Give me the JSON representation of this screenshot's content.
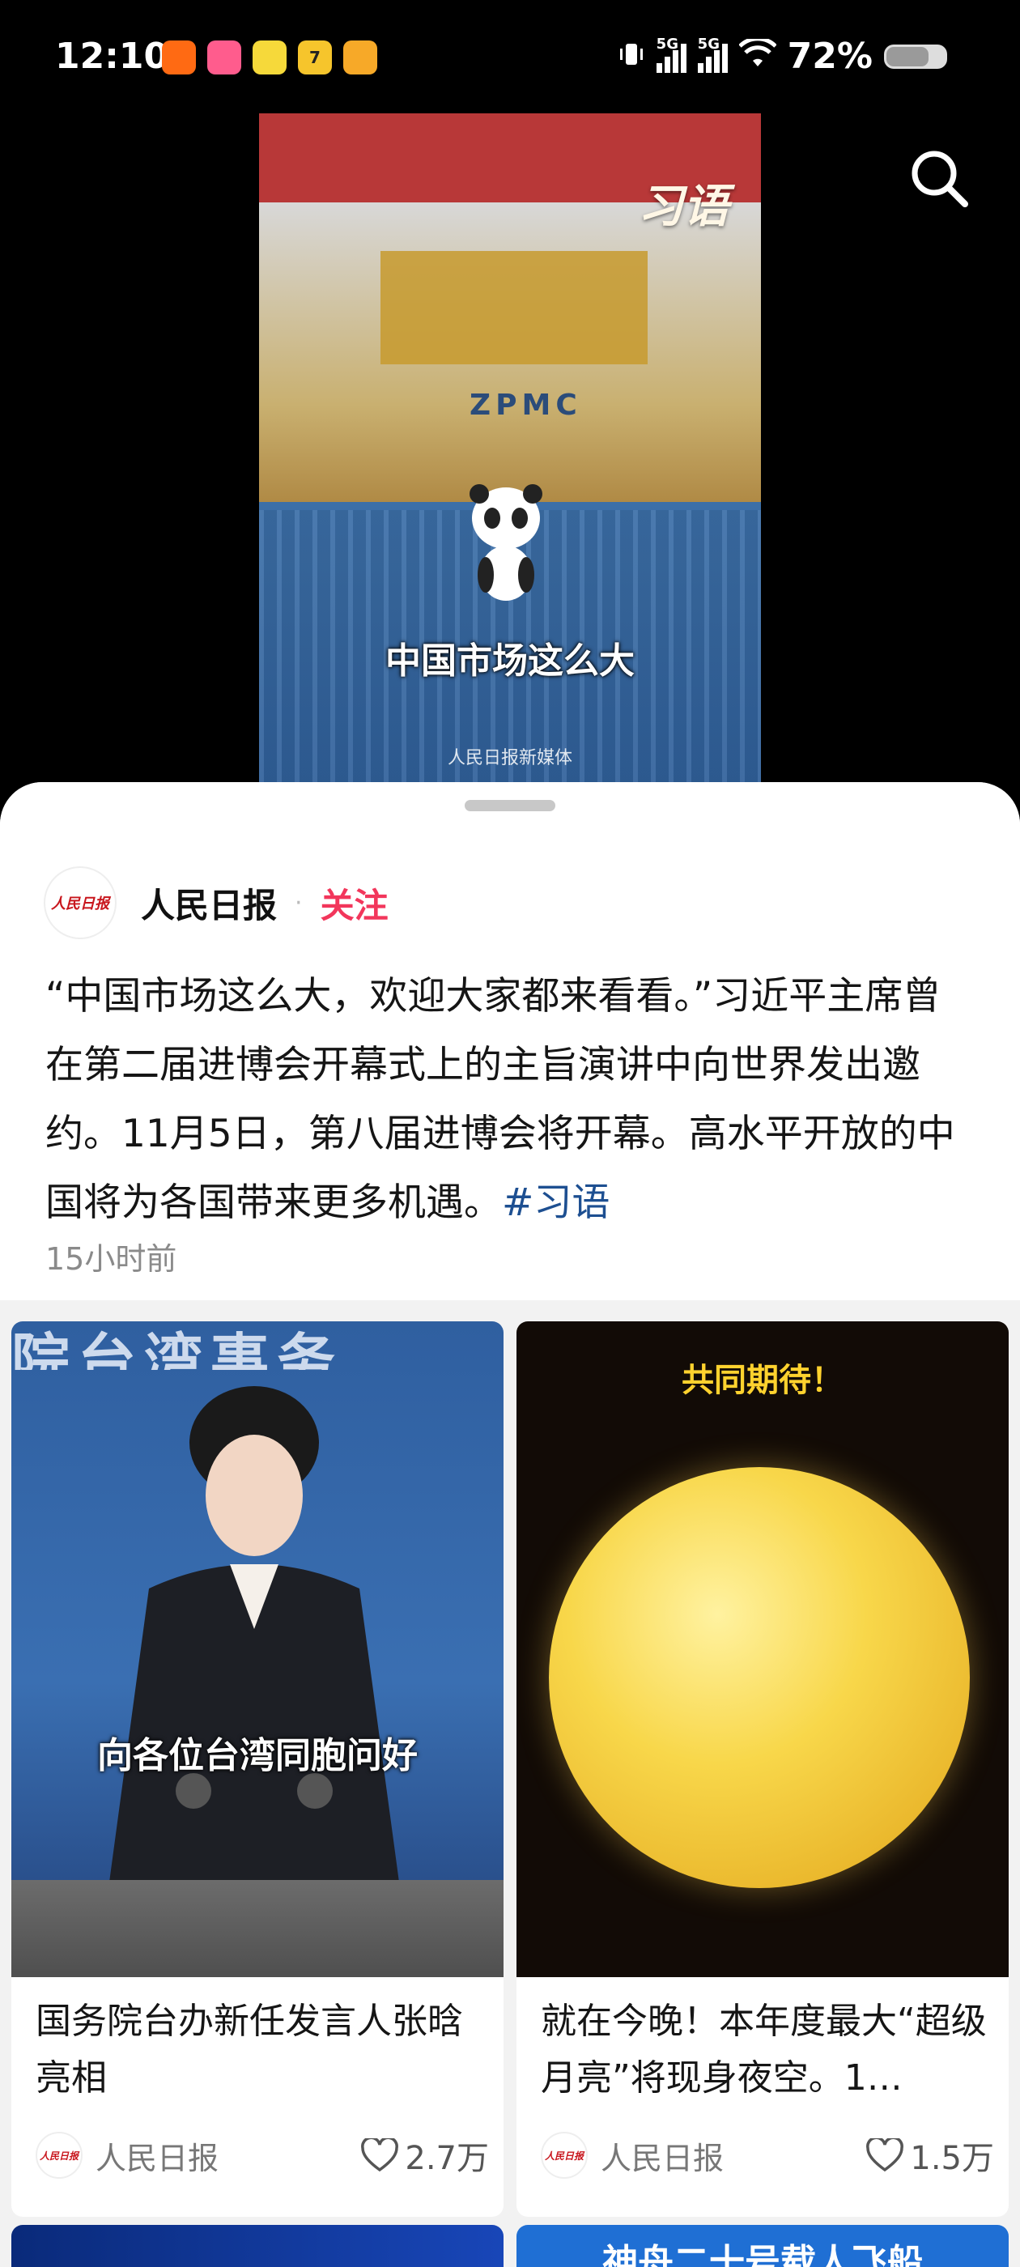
{
  "status_bar": {
    "time": "12:10",
    "app_icons": [
      {
        "name": "app-icon-1",
        "color": "#ff6a13",
        "label": ""
      },
      {
        "name": "app-icon-2",
        "color": "#ff5c8d",
        "label": ""
      },
      {
        "name": "app-icon-3",
        "color": "#f6d93a",
        "label": ""
      },
      {
        "name": "app-icon-4",
        "color": "#f6c52c",
        "label": "7"
      },
      {
        "name": "weibo-icon",
        "color": "#f7a928",
        "label": ""
      }
    ],
    "network_1": "5G",
    "network_2": "5G",
    "battery": "72%"
  },
  "video": {
    "brand_mark": "习语",
    "caption": "中国市场这么大",
    "watermark": "人民日报新媒体",
    "crane_text": "ZPMC"
  },
  "post": {
    "author": "人民日报",
    "avatar_text": "人民日报",
    "follow_label": "关注",
    "text": "“中国市场这么大，欢迎大家都来看看。”习近平主席曾在第二届进博会开幕式上的主旨演讲中向世界发出邀约。11月5日，第八届进博会将开幕。高水平开放的中国将为各国带来更多机遇。",
    "hashtag": "#习语",
    "time": "15小时前"
  },
  "cards": [
    {
      "thumb_banner": "院台湾事务",
      "thumb_caption": "向各位台湾同胞问好",
      "title": "国务院台办新任发言人张晗亮相",
      "author": "人民日报",
      "likes": "2.7万"
    },
    {
      "thumb_caption": "共同期待！",
      "title": "就在今晚！本年度最大“超级月亮”将现身夜空。1…",
      "author": "人民日报",
      "likes": "1.5万"
    }
  ],
  "peek_cards": [
    {
      "text": ""
    },
    {
      "text": "神舟二十号载人飞船"
    }
  ],
  "colors": {
    "follow": "#f2365b",
    "hashtag": "#1d4f91",
    "brand_red": "#c8161d"
  }
}
